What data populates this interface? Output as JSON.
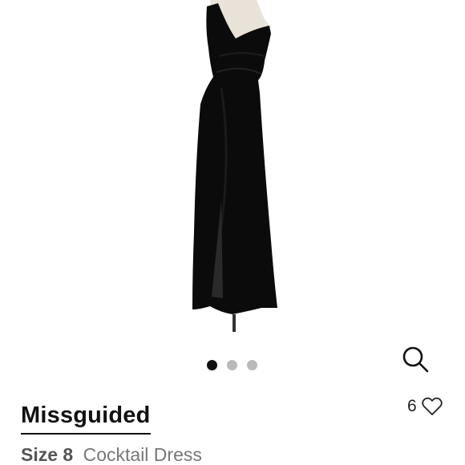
{
  "product": {
    "brand": "Missguided",
    "size_label": "Size 8",
    "category": "Cocktail Dress",
    "image_icon": "black-one-shoulder-maxi-dress"
  },
  "carousel": {
    "total": 3,
    "active_index": 0
  },
  "likes": {
    "count": "6",
    "icon": "heart-outline-icon"
  },
  "search": {
    "icon": "search-icon"
  },
  "colors": {
    "text_primary": "#111111",
    "text_secondary": "#777777",
    "dot_inactive": "#b9b9b9",
    "dot_active": "#111111"
  }
}
